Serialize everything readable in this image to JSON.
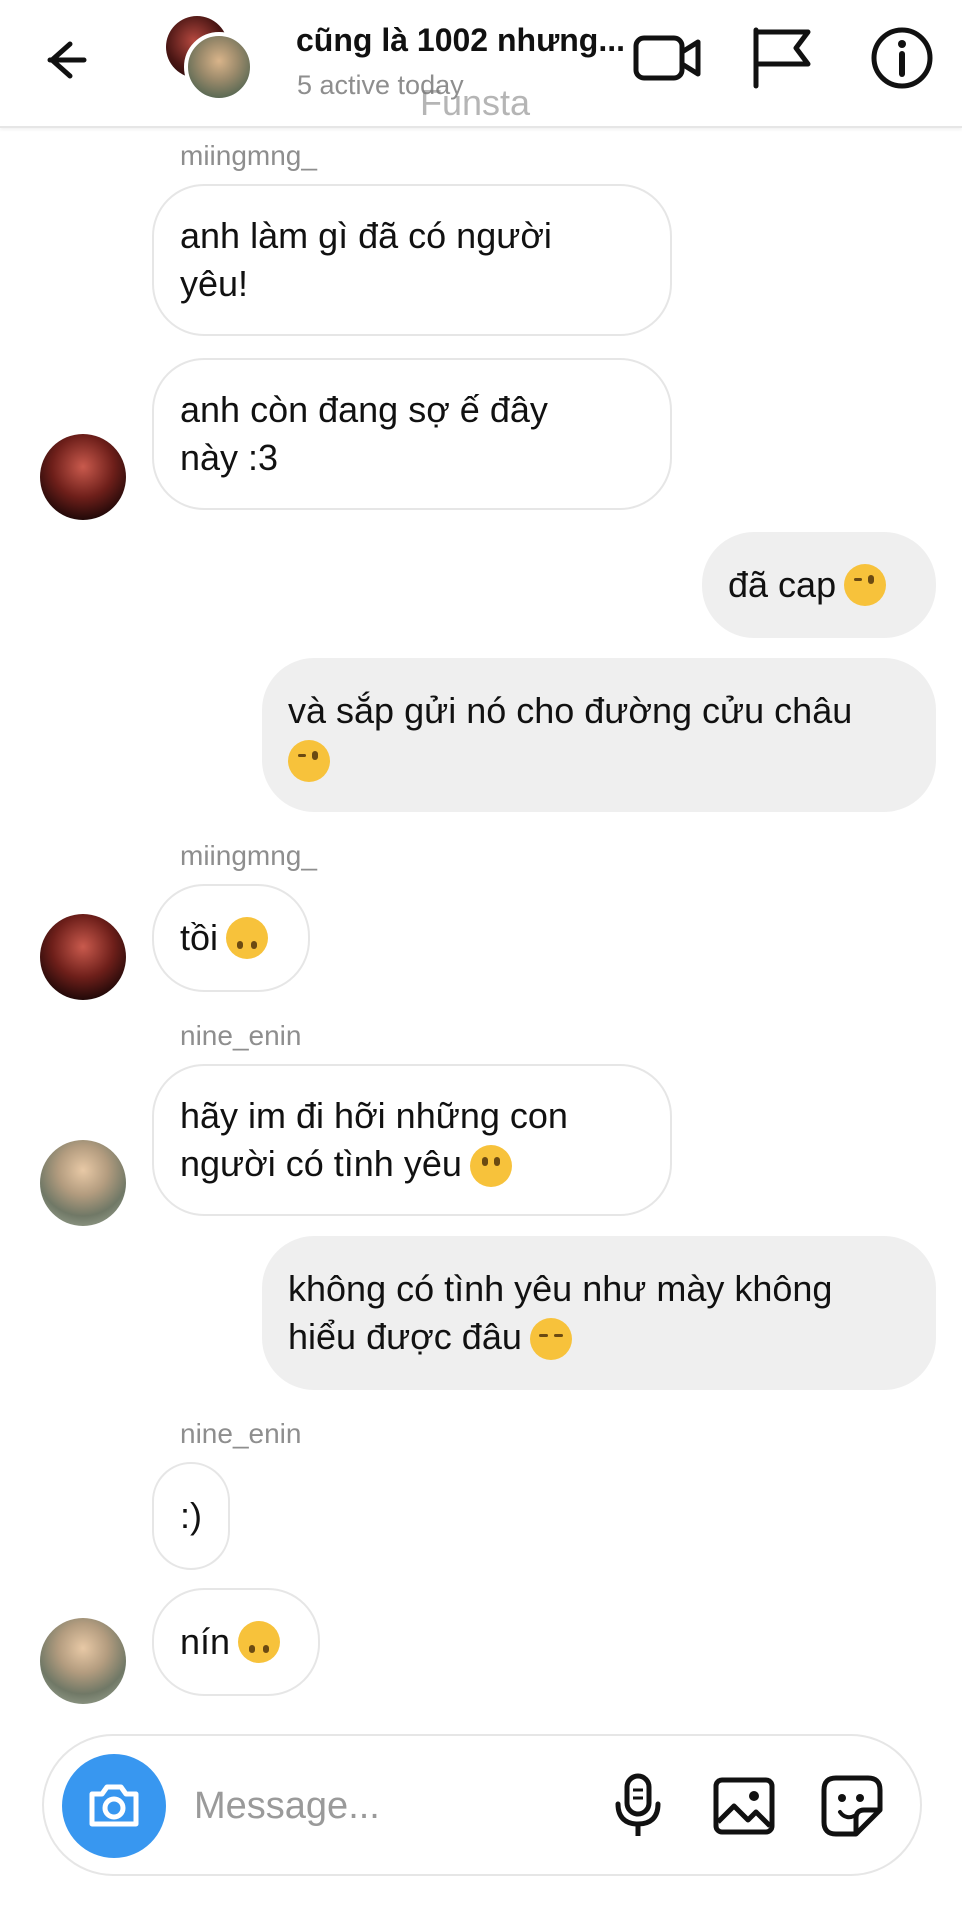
{
  "header": {
    "title": "cũng là 1002 nhưng...",
    "subtitle": "5 active today",
    "watermark": "Funsta",
    "icons": [
      "back-arrow-icon",
      "video-call-icon",
      "flag-icon",
      "info-icon"
    ]
  },
  "messages": [
    {
      "type": "in",
      "sender": "miingmng_",
      "lines": [
        "anh làm gì đã có người",
        "yêu!"
      ]
    },
    {
      "type": "in",
      "lines": [
        "anh còn đang sợ ế đây",
        "này :3"
      ],
      "avatar": "avatar-red-hair"
    },
    {
      "type": "out",
      "lines": [
        "đã cap"
      ],
      "emoji": "wink"
    },
    {
      "type": "out",
      "lines": [
        "và sắp gửi nó cho đường cửu châu"
      ],
      "emoji": "wink"
    },
    {
      "type": "in",
      "sender": "miingmng_",
      "lines": [
        "tồi"
      ],
      "emoji": "upside-down",
      "avatar": "avatar-red-hair"
    },
    {
      "type": "in",
      "sender": "nine_enin",
      "lines": [
        "hãy im đi hỡi những con",
        "người có tình yêu"
      ],
      "emoji": "slight-smile",
      "avatar": "avatar-boy"
    },
    {
      "type": "out",
      "lines": [
        "không có tình yêu như mày không",
        "hiểu được đâu"
      ],
      "emoji": "relieved"
    },
    {
      "type": "in",
      "sender": "nine_enin",
      "lines": [
        ":)"
      ]
    },
    {
      "type": "in",
      "lines": [
        "nín"
      ],
      "emoji": "upside-down",
      "avatar": "avatar-boy"
    }
  ],
  "composer": {
    "placeholder": "Message...",
    "icons": [
      "camera-icon",
      "microphone-icon",
      "gallery-icon",
      "sticker-icon"
    ]
  }
}
